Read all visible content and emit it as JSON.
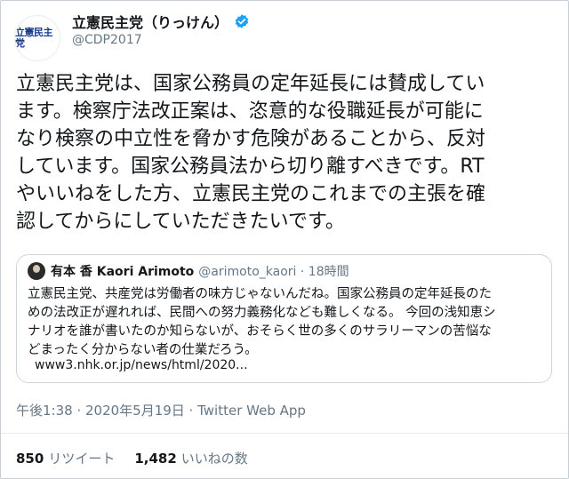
{
  "author": {
    "display_name": "立憲民主党（りっけん）",
    "handle": "@CDP2017",
    "avatar_logo": "立憲民主党",
    "verified_color": "#1da1f2"
  },
  "tweet": {
    "line1": "立憲民主党は、国家公務員の定年延長には賛成してい",
    "line2": "ます。検察庁法改正案は、恣意的な役職延長が可能に",
    "line3": "なり検察の中立性を脅かす危険があることから、反対",
    "line4": "しています。国家公務員法から切り離すべきです。RT",
    "line5": "やいいねをした方、立憲民主党のこれまでの主張を確",
    "line6": "認してからにしていただきたいです。"
  },
  "quote": {
    "name": "有本 香 Kaori Arimoto",
    "handle": "@arimoto_kaori · 18時間",
    "line1": "立憲民主党、共産党は労働者の味方じゃないんだね。国家公務員の定年延長のた",
    "line2": "めの法改正が遅れれば、民間への努力義務化なども難しくなる。 今回の浅知恵シ",
    "line3": "ナリオを誰が書いたのか知らないが、おそらく世の多くのサラリーマンの苦悩な",
    "line4": "どまったく分からない者の仕業だろう。",
    "link": "www3.nhk.or.jp/news/html/2020..."
  },
  "meta": {
    "timestamp": "午後1:38 · 2020年5月19日 · Twitter Web App"
  },
  "stats": {
    "retweets_count": "850",
    "retweets_label": "リツイート",
    "likes_count": "1,482",
    "likes_label": "いいねの数"
  }
}
